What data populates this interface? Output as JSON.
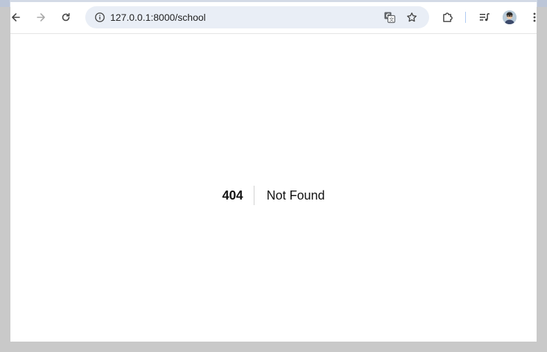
{
  "browser": {
    "url": "127.0.0.1:8000/school",
    "icons": [
      "back-icon",
      "forward-icon",
      "reload-icon",
      "site-info-icon",
      "translate-icon",
      "bookmark-star-icon",
      "extensions-icon",
      "media-icon",
      "avatar",
      "menu-icon"
    ]
  },
  "page": {
    "error_code": "404",
    "error_message": "Not Found"
  }
}
